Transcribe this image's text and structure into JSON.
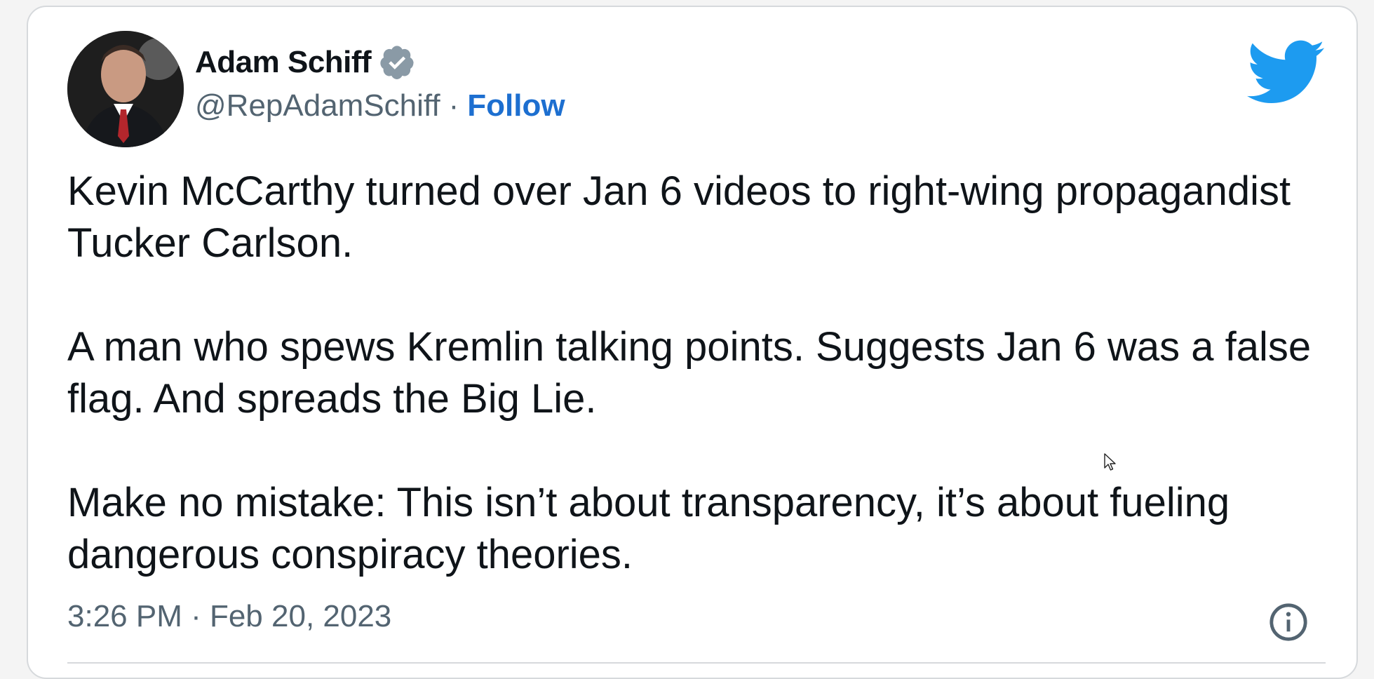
{
  "author": {
    "display_name": "Adam Schiff",
    "handle": "@RepAdamSchiff",
    "separator": "·",
    "follow_label": "Follow",
    "verified_icon": "verified-badge-icon",
    "avatar": "avatar-photo"
  },
  "brand": {
    "logo_icon": "twitter-bird-icon",
    "accent_color": "#1d9bf0",
    "link_color": "#1d6fd0"
  },
  "tweet": {
    "paragraphs": [
      "Kevin McCarthy turned over Jan 6 videos to right-wing propagandist Tucker Carlson.",
      "A man who spews Kremlin talking points. Suggests Jan 6 was a false flag. And spreads the Big Lie.",
      "Make no mistake: This isn’t about transparency, it’s about fueling dangerous conspiracy theories."
    ],
    "timestamp": "3:26 PM · Feb 20, 2023",
    "info_icon": "info-icon"
  }
}
